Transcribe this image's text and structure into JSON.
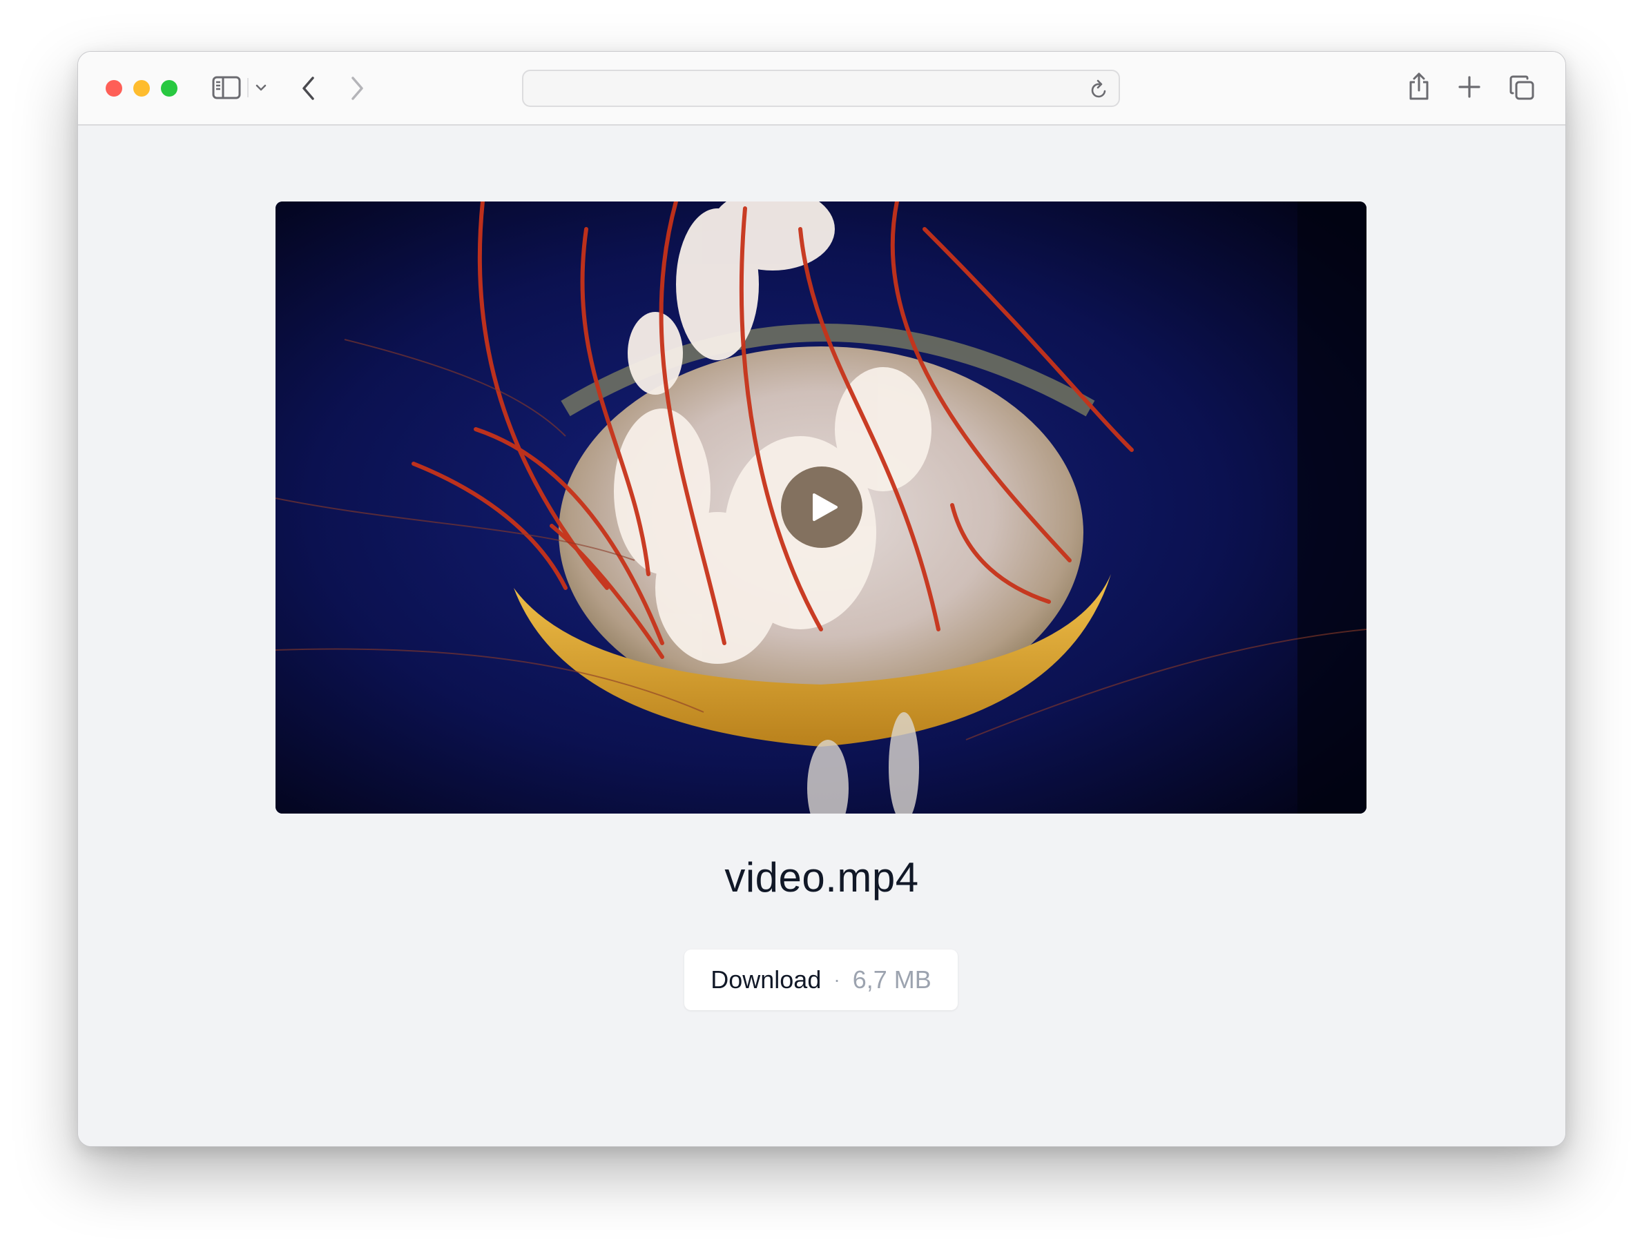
{
  "browser": {
    "address_value": "",
    "icons": {
      "sidebar": "sidebar-icon",
      "sidebar_menu": "chevron-down-icon",
      "back": "chevron-left-icon",
      "forward": "chevron-right-icon",
      "reload": "reload-icon",
      "share": "share-icon",
      "new_tab": "plus-icon",
      "tabs": "tab-overview-icon"
    },
    "colors": {
      "close": "#fe5f57",
      "minimize": "#febc2e",
      "zoom": "#28c840"
    }
  },
  "media": {
    "filename": "video.mp4",
    "play_icon": "play-icon",
    "download_label": "Download",
    "separator": "·",
    "file_size": "6,7 MB"
  }
}
